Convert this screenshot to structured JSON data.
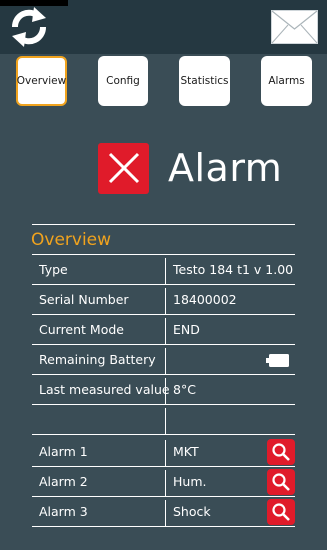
{
  "header": {
    "refresh_icon": "refresh-icon",
    "mail_icon": "mail-icon"
  },
  "tabs": [
    {
      "label": "Overview",
      "active": true
    },
    {
      "label": "Config",
      "active": false
    },
    {
      "label": "Statistics",
      "active": false
    },
    {
      "label": "Alarms",
      "active": false
    }
  ],
  "status": {
    "label": "Alarm",
    "icon": "close-icon",
    "color": "#e01b2a"
  },
  "overview": {
    "title": "Overview",
    "rows": [
      {
        "label": "Type",
        "value": "Testo 184 t1 v 1.00"
      },
      {
        "label": "Serial Number",
        "value": "18400002"
      },
      {
        "label": "Current Mode",
        "value": "END"
      },
      {
        "label": "Remaining Battery",
        "value": "",
        "icon": "battery-icon"
      },
      {
        "label": "Last measured value",
        "value": "8°C"
      },
      {
        "label": "",
        "value": ""
      }
    ],
    "alarms": [
      {
        "label": "Alarm 1",
        "value": "MKT",
        "icon": "search-icon"
      },
      {
        "label": "Alarm 2",
        "value": "Hum.",
        "icon": "search-icon"
      },
      {
        "label": "Alarm 3",
        "value": "Shock",
        "icon": "search-icon"
      }
    ]
  },
  "colors": {
    "background": "#3a4d56",
    "header": "#253841",
    "accent": "#f0a31e",
    "alarm_red": "#e01b2a"
  }
}
